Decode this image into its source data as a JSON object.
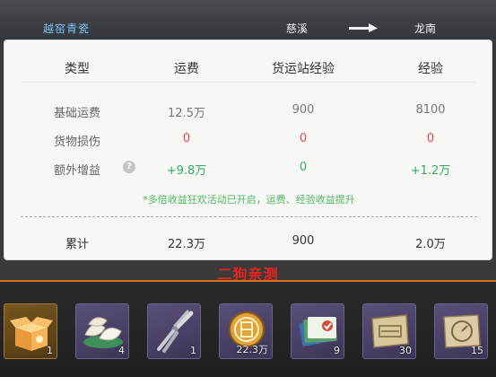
{
  "route": {
    "cargo": "越窑青瓷",
    "from": "慈溪",
    "to": "龙南"
  },
  "table": {
    "headers": [
      "类型",
      "运费",
      "货运站经验",
      "经验"
    ],
    "rows": [
      {
        "label": "基础运费",
        "values": [
          "12.5万",
          "900",
          "8100"
        ]
      },
      {
        "label": "货物损伤",
        "values": [
          "0",
          "0",
          "0"
        ]
      },
      {
        "label": "额外增益",
        "values": [
          "+9.8万",
          "0",
          "+1.2万"
        ]
      }
    ],
    "note": "*多倍收益狂欢活动已开启，运费、经验收益提升",
    "total": {
      "label": "累计",
      "values": [
        "22.3万",
        "900",
        "2.0万"
      ]
    },
    "help_icon_glyph": "?"
  },
  "watermark": "二狗亲测",
  "items": [
    {
      "name": "cargo-box-icon",
      "count": "1"
    },
    {
      "name": "dumplings-icon",
      "count": "4"
    },
    {
      "name": "pliers-icon",
      "count": "1"
    },
    {
      "name": "gold-coin-icon",
      "count": "22.3万"
    },
    {
      "name": "cash-bundle-icon",
      "count": "9"
    },
    {
      "name": "ticket-scroll-icon",
      "count": "30"
    },
    {
      "name": "gauge-scroll-icon",
      "count": "15"
    }
  ],
  "colors": {
    "accent_orange": "#d2741c",
    "cargo_blue": "#7fc1f0",
    "loss_red": "#e24a4a",
    "bonus_green": "#2fad5a",
    "watermark_red": "#e8231f"
  }
}
